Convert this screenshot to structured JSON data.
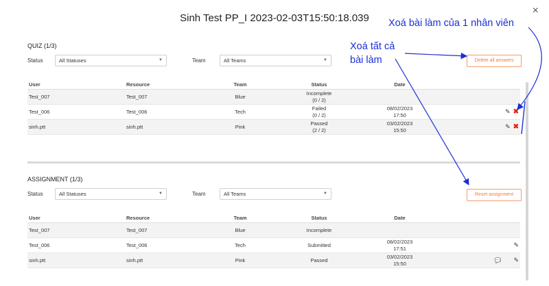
{
  "modal": {
    "title": "Sinh Test PP_I 2023-02-03T15:50:18.039",
    "close": "×"
  },
  "quiz": {
    "title": "QUIZ (1/3)",
    "status_label": "Status",
    "status_value": "All Statuses",
    "team_label": "Team",
    "team_value": "All Teams",
    "action": "Delete all answers",
    "headers": {
      "user": "User",
      "resource": "Resource",
      "team": "Team",
      "status": "Status",
      "date": "Date"
    },
    "rows": [
      {
        "user": "Test_007",
        "resource": "Test_007",
        "team": "Blue",
        "status": "Incomplete",
        "score": "(0 / 2)",
        "date": "",
        "time": ""
      },
      {
        "user": "Test_006",
        "resource": "Test_006",
        "team": "Tech",
        "status": "Failed",
        "score": "(0 / 2)",
        "date": "08/02/2023",
        "time": "17:50"
      },
      {
        "user": "sinh.ptt",
        "resource": "sinh.ptt",
        "team": "Pink",
        "status": "Passed",
        "score": "(2 / 2)",
        "date": "03/02/2023",
        "time": "15:50"
      }
    ]
  },
  "assignment": {
    "title": "ASSIGNMENT (1/3)",
    "status_label": "Status",
    "status_value": "All Statuses",
    "team_label": "Team",
    "team_value": "All Teams",
    "action": "Reset assignment",
    "headers": {
      "user": "User",
      "resource": "Resource",
      "team": "Team",
      "status": "Status",
      "date": "Date"
    },
    "rows": [
      {
        "user": "Test_007",
        "resource": "Test_007",
        "team": "Blue",
        "status": "Incomplete",
        "date": "",
        "time": ""
      },
      {
        "user": "Test_006",
        "resource": "Test_006",
        "team": "Tech",
        "status": "Submitted",
        "date": "08/02/2023",
        "time": "17:51"
      },
      {
        "user": "sinh.ptt",
        "resource": "sinh.ptt",
        "team": "Pink",
        "status": "Passed",
        "date": "03/02/2023",
        "time": "15:50"
      }
    ]
  },
  "annotations": {
    "delete_one": "Xoá bài làm của 1 nhân viên",
    "delete_all_line1": "Xoá tất cả",
    "delete_all_line2": "bài làm"
  },
  "colors": {
    "accent": "#f07d3e",
    "annotation": "#1a2fd6",
    "delete": "#e2231a"
  },
  "icons": {
    "edit": "edit-icon",
    "delete": "delete-icon",
    "chat": "comment-icon",
    "dropdown": "chevron-down-icon",
    "close": "close-icon"
  }
}
